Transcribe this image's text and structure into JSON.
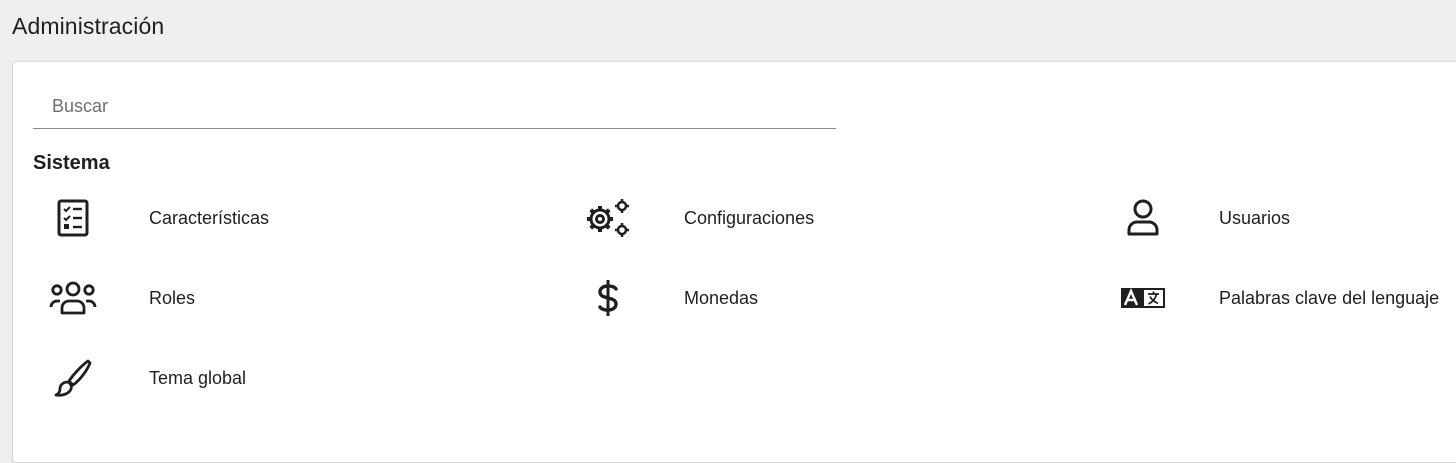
{
  "page": {
    "title": "Administración"
  },
  "search": {
    "placeholder": "Buscar",
    "value": ""
  },
  "section": {
    "title": "Sistema",
    "items": [
      {
        "label": "Características",
        "icon": "checklist-icon"
      },
      {
        "label": "Configuraciones",
        "icon": "gears-icon"
      },
      {
        "label": "Usuarios",
        "icon": "user-icon"
      },
      {
        "label": "Roles",
        "icon": "users-group-icon"
      },
      {
        "label": "Monedas",
        "icon": "dollar-icon"
      },
      {
        "label": "Palabras clave del lenguaje",
        "icon": "language-icon"
      },
      {
        "label": "Tema global",
        "icon": "brush-icon"
      }
    ]
  },
  "colors": {
    "background": "#efefef",
    "card": "#ffffff",
    "text": "#1f1f1f",
    "icon": "#1f1f1f"
  }
}
